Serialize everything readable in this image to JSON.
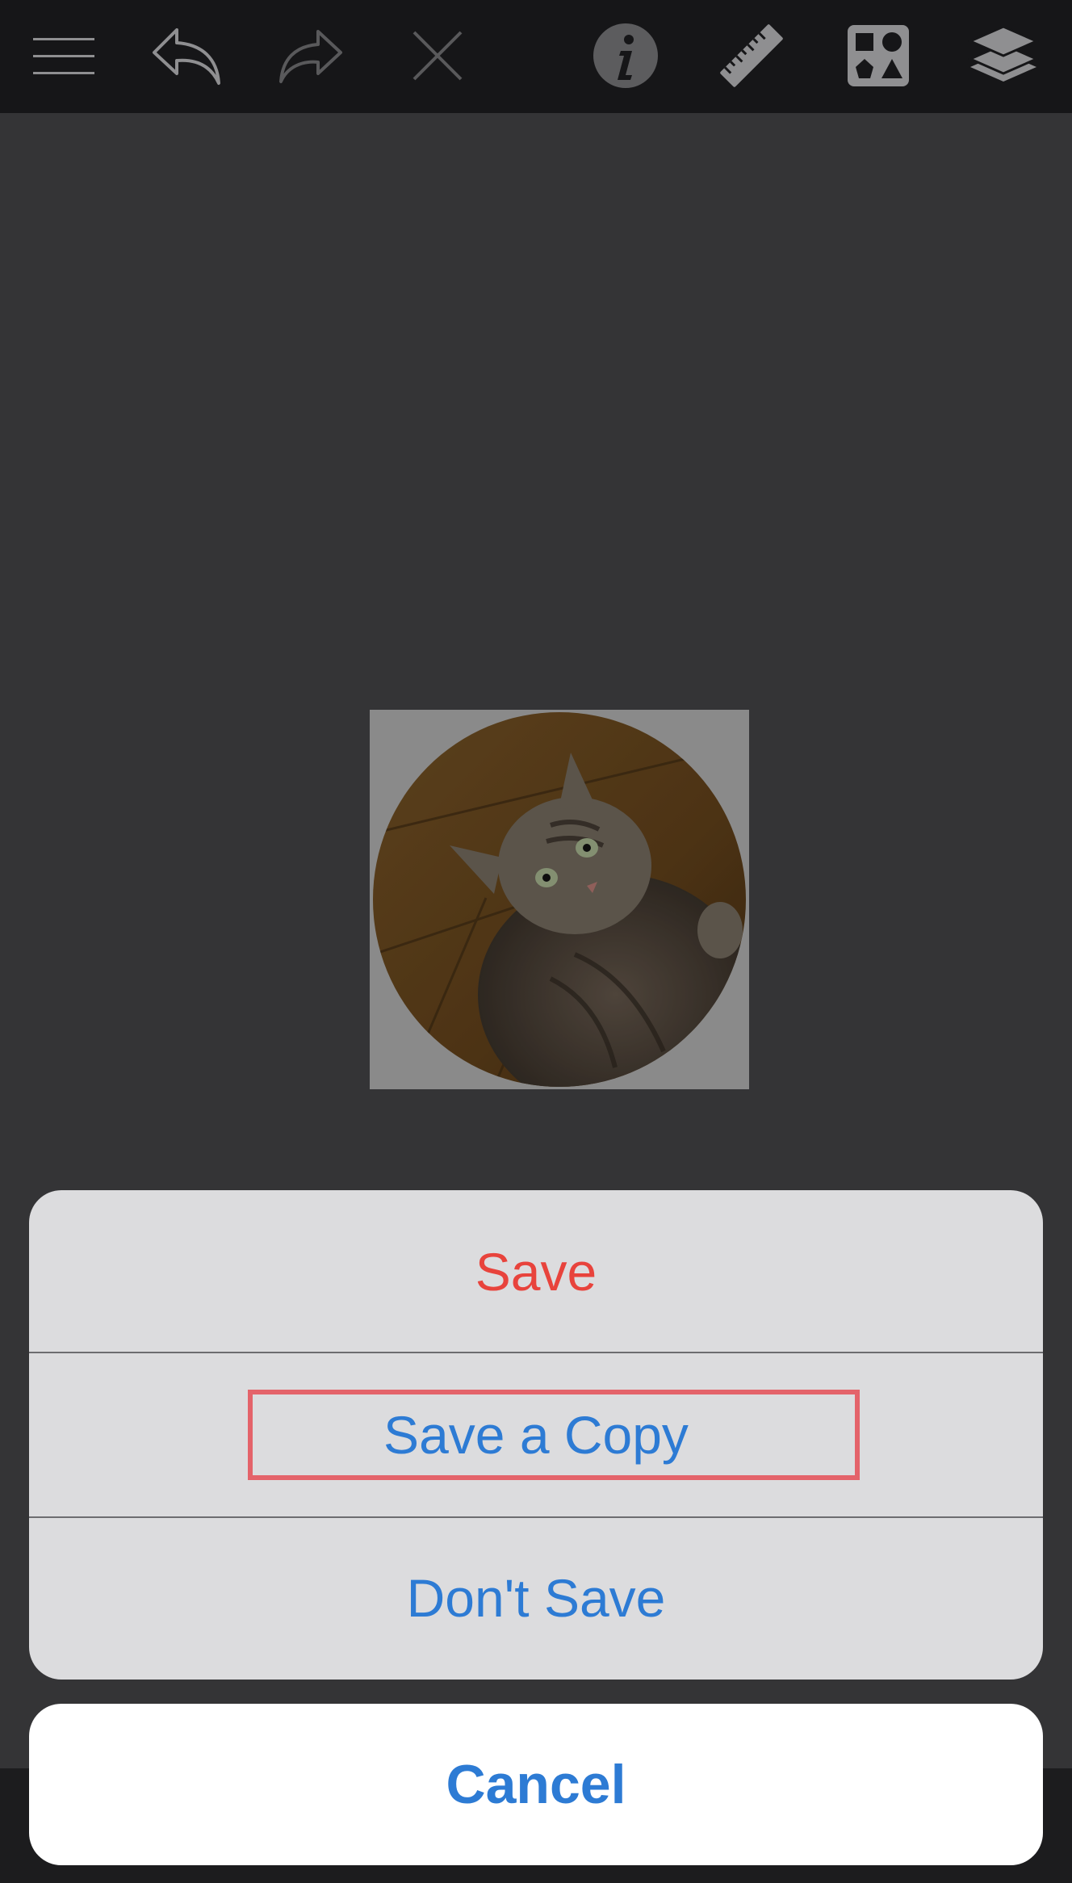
{
  "toolbar": {
    "icons": [
      "menu-icon",
      "undo-icon",
      "redo-icon",
      "close-icon",
      "info-icon",
      "ruler-icon",
      "shapes-icon",
      "layers-icon"
    ]
  },
  "action_sheet": {
    "items": [
      {
        "label": "Save"
      },
      {
        "label": "Save a Copy"
      },
      {
        "label": "Don't Save"
      }
    ],
    "cancel_label": "Cancel"
  },
  "colors": {
    "accent": "#2d7bd4",
    "destructive": "#e8433c",
    "highlight": "#e4636a"
  }
}
